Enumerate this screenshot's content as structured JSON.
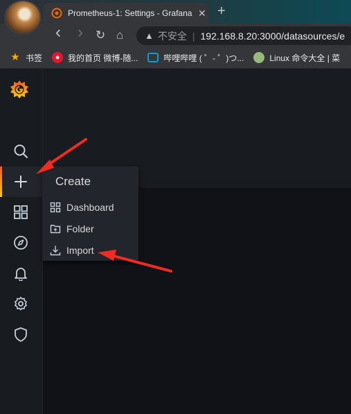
{
  "browser": {
    "tab_title": "Prometheus-1: Settings - Grafana",
    "tab_close": "✕",
    "new_tab": "+",
    "nav": {
      "back": "‹",
      "forward": "›",
      "reload": "↻",
      "home": "⌂"
    },
    "address": {
      "insecure_label": "不安全",
      "separator": "|",
      "url": "192.168.8.20:3000/datasources/e"
    },
    "bookmarks": [
      {
        "label": "书签",
        "icon": "star-icon",
        "color": "#f9ab00"
      },
      {
        "label": "我的首页 微博-随...",
        "icon": "weibo-icon",
        "color": "#e6162d"
      },
      {
        "label": "哔哩哔哩 ( ゜- ゜)つ...",
        "icon": "bilibili-icon",
        "color": "#00a1d6"
      },
      {
        "label": "Linux 命令大全 | 菜",
        "icon": "runoob-icon",
        "color": "#96b97d"
      }
    ]
  },
  "sidemenu": {
    "items": [
      "grafana-logo",
      "search-icon",
      "plus-icon",
      "dashboards-icon",
      "explore-icon",
      "alerting-icon",
      "configuration-icon",
      "shield-icon"
    ]
  },
  "create_menu": {
    "header": "Create",
    "items": [
      {
        "label": "Dashboard",
        "icon": "dashboard-grid-icon"
      },
      {
        "label": "Folder",
        "icon": "folder-plus-icon"
      },
      {
        "label": "Import",
        "icon": "import-icon"
      }
    ]
  },
  "colors": {
    "accent_orange": "#f05a28",
    "annotation_red": "#ef2b22",
    "sidebar_bg": "#181b1f",
    "canvas_bg": "#111217"
  }
}
